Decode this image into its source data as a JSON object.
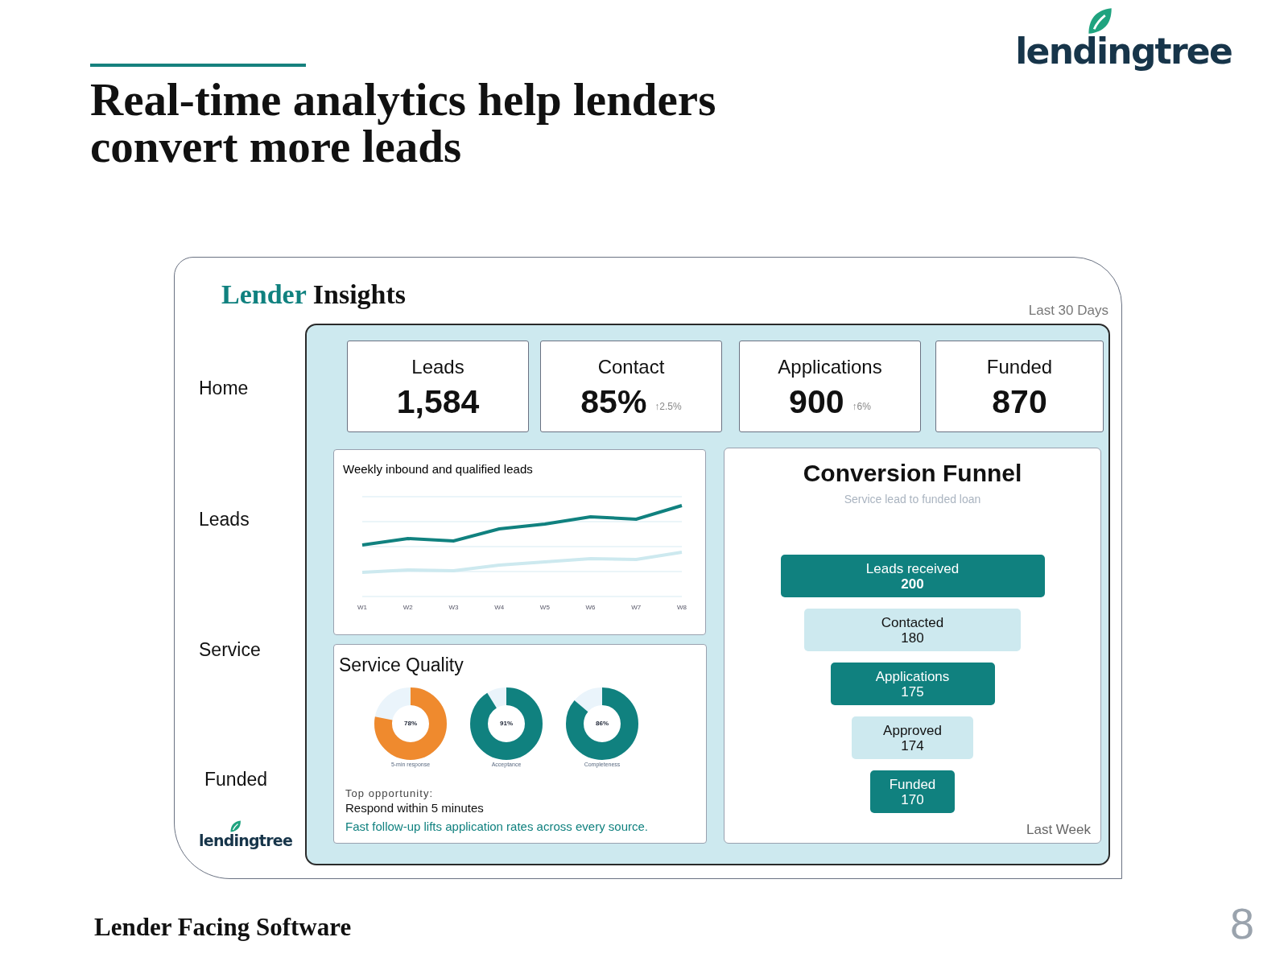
{
  "slide": {
    "title": "Real-time analytics help lenders convert more leads",
    "logo": "lendingtree",
    "footer": "Lender Facing Software",
    "page_number": "8"
  },
  "app": {
    "title_accent": "Lender",
    "title_rest": "Insights",
    "period": "Last 30 Days",
    "nav": [
      "Home",
      "Leads",
      "Service",
      "Funded"
    ],
    "sidebar_logo": "lendingtree",
    "kpis": [
      {
        "label": "Leads",
        "value": "1,584"
      },
      {
        "label": "Contact",
        "value": "85%",
        "delta": "↑2.5%"
      },
      {
        "label": "Applications",
        "value": "900",
        "delta": "↑6%"
      },
      {
        "label": "Funded",
        "value": "870"
      }
    ],
    "leads_chart": {
      "title": "Weekly inbound and qualified leads",
      "x_labels": [
        "W1",
        "W2",
        "W3",
        "W4",
        "W5",
        "W6",
        "W7",
        "W8"
      ]
    },
    "service_quality": {
      "title": "Service Quality",
      "donuts": [
        {
          "value": "78%",
          "label": "5-min response",
          "color": "#ef8a2e"
        },
        {
          "value": "91%",
          "label": "Acceptance",
          "color": "#10817f"
        },
        {
          "value": "86%",
          "label": "Completeness",
          "color": "#10817f"
        }
      ],
      "opportunity_label": "Top opportunity:",
      "opportunity": "Respond within 5 minutes",
      "note": "Fast follow-up lifts application rates across every source."
    },
    "funnel": {
      "title": "Conversion Funnel",
      "subtitle": "Service lead to funded loan",
      "footer": "Last Week",
      "stages": [
        {
          "label": "Leads received",
          "value": "200",
          "kind": "filled",
          "bold_value": true
        },
        {
          "label": "Contacted",
          "value": "180",
          "kind": "light",
          "bold_value": false
        },
        {
          "label": "Applications",
          "value": "175",
          "kind": "filled",
          "bold_value": false
        },
        {
          "label": "Approved",
          "value": "174",
          "kind": "light",
          "bold_value": false
        },
        {
          "label": "Funded",
          "value": "170",
          "kind": "filled",
          "bold_value": false
        }
      ]
    }
  }
}
